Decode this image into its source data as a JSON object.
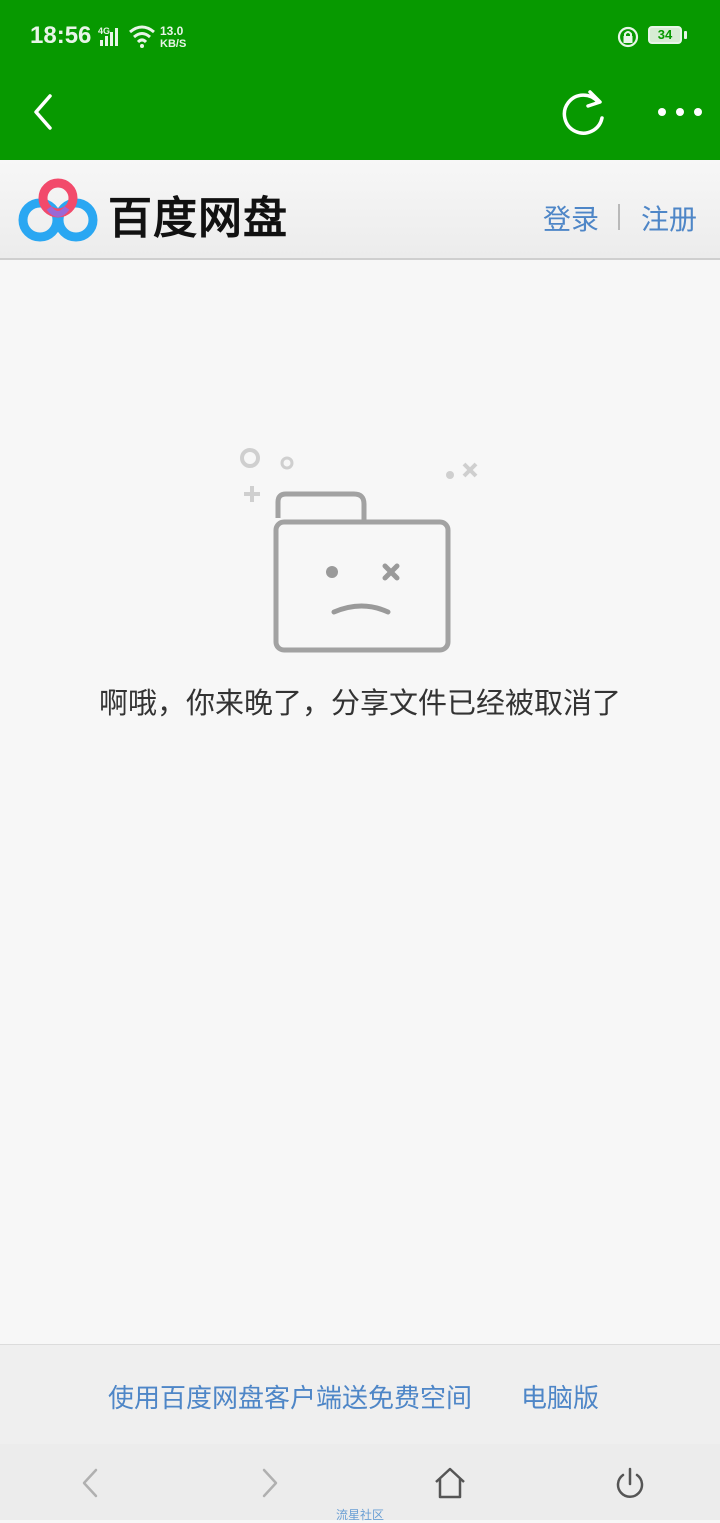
{
  "status_bar": {
    "time": "18:56",
    "network_type": "4G",
    "net_speed_value": "13.0",
    "net_speed_unit": "KB/S",
    "battery_level": "34",
    "background_color": "#079900"
  },
  "toolbar": {
    "back_icon": "chevron-left-icon",
    "refresh_icon": "refresh-icon",
    "more_icon": "more-dots-icon"
  },
  "header": {
    "brand": "百度网盘",
    "login": "登录",
    "register": "注册",
    "link_color": "#4e86c7"
  },
  "main": {
    "illustration": "sad-folder-icon",
    "message": "啊哦，你来晚了，分享文件已经被取消了"
  },
  "footer": {
    "client_promo": "使用百度网盘客户端送免费空间",
    "desktop_version": "电脑版"
  },
  "nav_bar": {
    "watermark": "流星社区"
  }
}
